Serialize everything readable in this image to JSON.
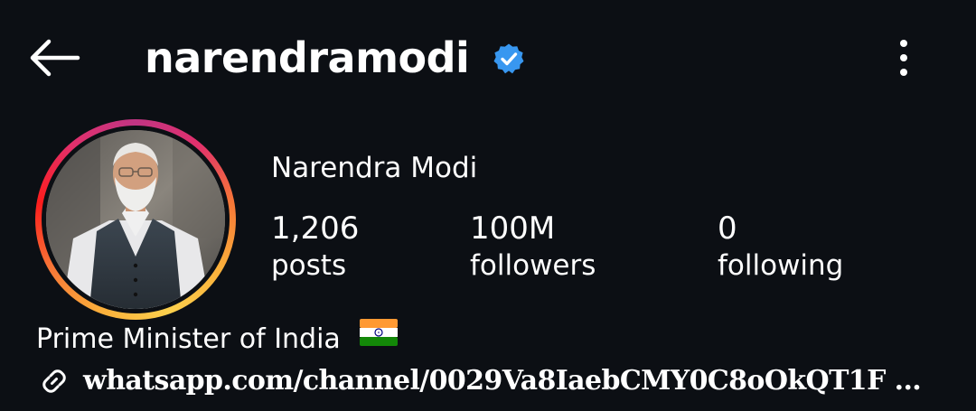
{
  "header": {
    "username": "narendramodi",
    "back_icon": "back-arrow-icon",
    "verified_icon": "verified-badge-icon",
    "more_icon": "more-vertical-icon",
    "verified_color": "#3897f0"
  },
  "profile": {
    "full_name": "Narendra Modi",
    "stats": {
      "posts": {
        "value": "1,206",
        "label": "posts"
      },
      "followers": {
        "value": "100M",
        "label": "followers"
      },
      "following": {
        "value": "0",
        "label": "following"
      }
    },
    "bio": "Prime Minister of India",
    "bio_emoji": "india-flag-emoji",
    "link_icon": "link-icon",
    "link": "whatsapp.com/channel/0029Va8IaebCMY0C8oOkQT1F ..."
  },
  "colors": {
    "background": "#0c0f14",
    "text": "#ffffff",
    "story_ring": [
      "#fbb03b",
      "#f77737",
      "#fd1d1d",
      "#e1306c",
      "#c13584"
    ]
  }
}
